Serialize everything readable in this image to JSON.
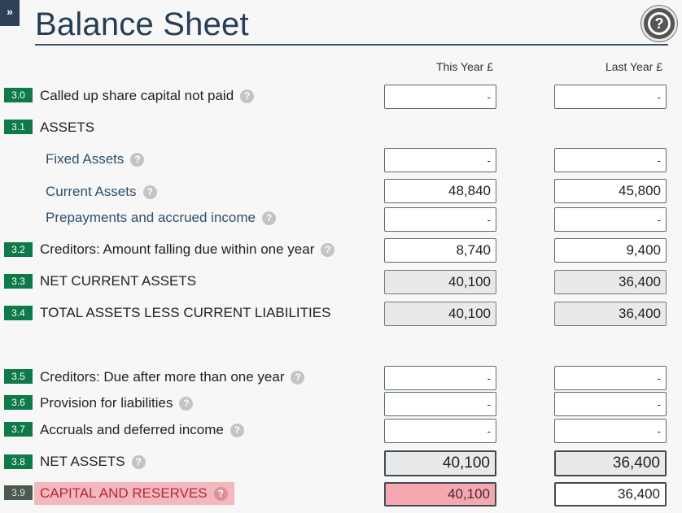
{
  "header": {
    "expand_label": "»",
    "title": "Balance Sheet",
    "help_label": "?"
  },
  "columns": {
    "this_year": "This Year £",
    "last_year": "Last Year £"
  },
  "rows": [
    {
      "code": "3.0",
      "label": "Called up share capital not paid",
      "this": "-",
      "last": "-"
    },
    {
      "code": "3.1",
      "label": "ASSETS"
    },
    {
      "label": "Fixed Assets",
      "this": "-",
      "last": "-"
    },
    {
      "label": "Current Assets",
      "this": "48,840",
      "last": "45,800"
    },
    {
      "label": "Prepayments and accrued income",
      "this": "-",
      "last": "-"
    },
    {
      "code": "3.2",
      "label": "Creditors: Amount falling due within one year",
      "this": "8,740",
      "last": "9,400"
    },
    {
      "code": "3.3",
      "label": "NET CURRENT ASSETS",
      "this": "40,100",
      "last": "36,400"
    },
    {
      "code": "3.4",
      "label": "TOTAL ASSETS LESS CURRENT LIABILITIES",
      "this": "40,100",
      "last": "36,400"
    },
    {
      "code": "3.5",
      "label": "Creditors: Due after more than one year",
      "this": "-",
      "last": "-"
    },
    {
      "code": "3.6",
      "label": "Provision for liabilities",
      "this": "-",
      "last": "-"
    },
    {
      "code": "3.7",
      "label": "Accruals and deferred income",
      "this": "-",
      "last": "-"
    },
    {
      "code": "3.8",
      "label": "NET ASSETS",
      "this": "40,100",
      "last": "36,400"
    },
    {
      "code": "3.9",
      "label": "CAPITAL AND RESERVES",
      "this": "40,100",
      "last": "36,400"
    }
  ],
  "help_icon_glyph": "?"
}
